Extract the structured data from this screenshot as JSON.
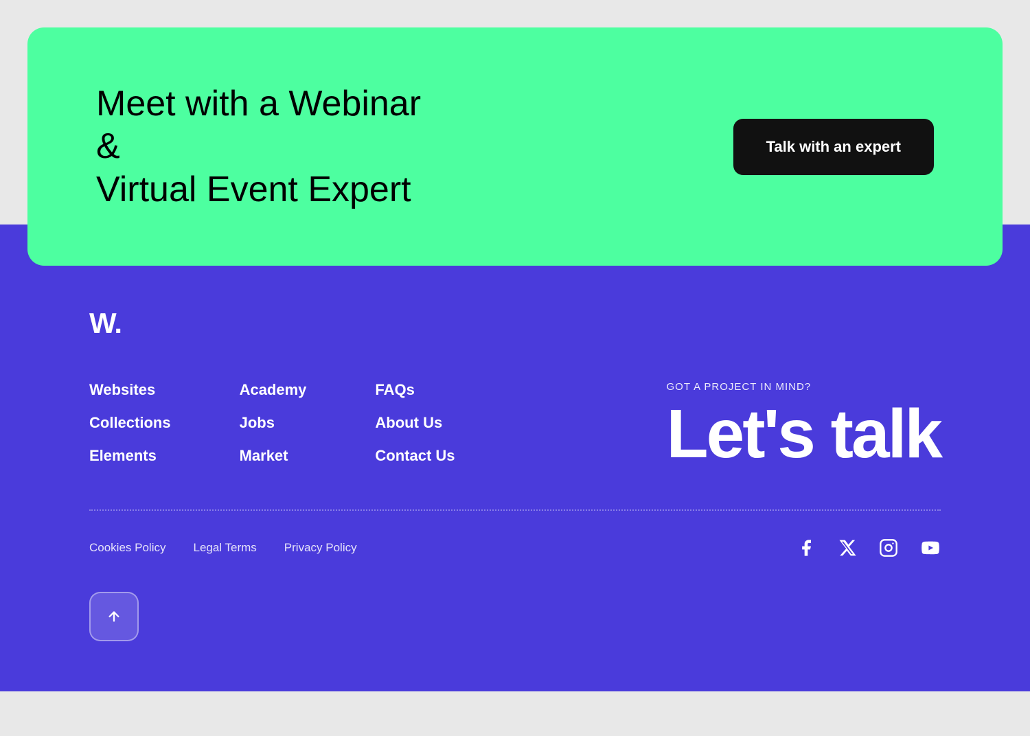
{
  "hero": {
    "title": "Meet with a Webinar &\nVirtual Event Expert",
    "cta_label": "Talk with an expert"
  },
  "footer": {
    "logo": "W.",
    "nav_col1": {
      "items": [
        {
          "label": "Websites",
          "href": "#"
        },
        {
          "label": "Collections",
          "href": "#"
        },
        {
          "label": "Elements",
          "href": "#"
        }
      ]
    },
    "nav_col2": {
      "items": [
        {
          "label": "Academy",
          "href": "#"
        },
        {
          "label": "Jobs",
          "href": "#"
        },
        {
          "label": "Market",
          "href": "#"
        }
      ]
    },
    "nav_col3": {
      "items": [
        {
          "label": "FAQs",
          "href": "#"
        },
        {
          "label": "About Us",
          "href": "#"
        },
        {
          "label": "Contact Us",
          "href": "#"
        }
      ]
    },
    "cta_label": "GOT A PROJECT IN MIND?",
    "cta_heading": "Let's talk",
    "legal": {
      "cookies": "Cookies Policy",
      "terms": "Legal Terms",
      "privacy": "Privacy Policy"
    },
    "social": {
      "facebook": "f",
      "x": "𝕏",
      "instagram": "instagram",
      "youtube": "youtube"
    }
  }
}
